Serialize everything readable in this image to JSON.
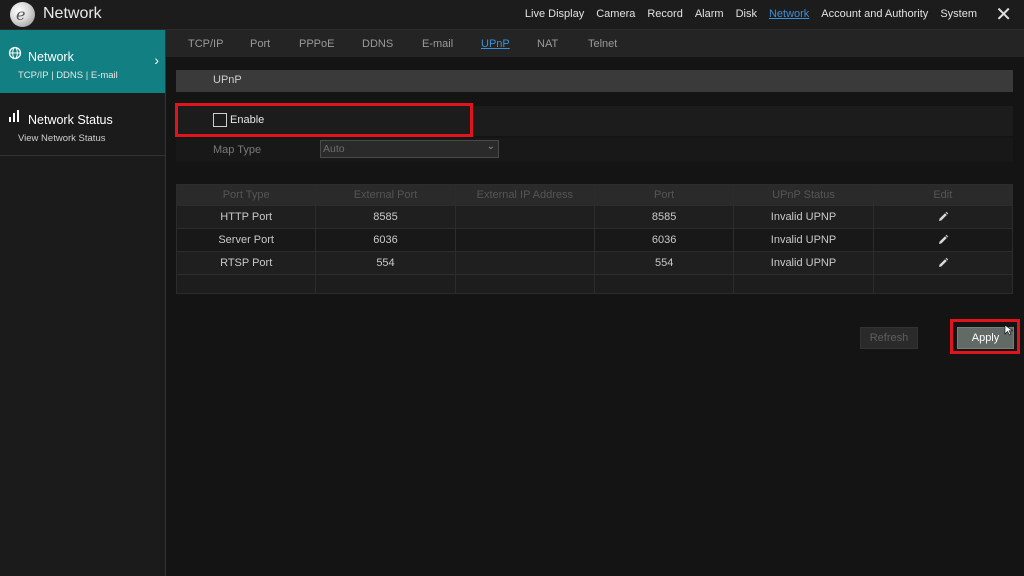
{
  "header": {
    "app_title": "Network",
    "nav_items": [
      {
        "label": "Live Display",
        "active": false
      },
      {
        "label": "Camera",
        "active": false
      },
      {
        "label": "Record",
        "active": false
      },
      {
        "label": "Alarm",
        "active": false
      },
      {
        "label": "Disk",
        "active": false
      },
      {
        "label": "Network",
        "active": true
      },
      {
        "label": "Account and Authority",
        "active": false
      },
      {
        "label": "System",
        "active": false
      }
    ],
    "close_icon": "close-icon"
  },
  "sidebar": {
    "items": [
      {
        "title": "Network",
        "subtitle": "TCP/IP | DDNS | E-mail",
        "icon": "globe-icon",
        "selected": true
      },
      {
        "title": "Network Status",
        "subtitle": "View Network Status",
        "icon": "signal-icon",
        "selected": false
      }
    ]
  },
  "subtabs": [
    {
      "label": "TCP/IP",
      "active": false
    },
    {
      "label": "Port",
      "active": false
    },
    {
      "label": "PPPoE",
      "active": false
    },
    {
      "label": "DDNS",
      "active": false
    },
    {
      "label": "E-mail",
      "active": false
    },
    {
      "label": "UPnP",
      "active": true
    },
    {
      "label": "NAT",
      "active": false
    },
    {
      "label": "Telnet",
      "active": false
    }
  ],
  "upnp": {
    "section_title": "UPnP",
    "enable_label": "Enable",
    "enable_checked": false,
    "map_type_label": "Map Type",
    "map_type_value": "Auto"
  },
  "table": {
    "headers": [
      "Port Type",
      "External Port",
      "External IP Address",
      "Port",
      "UPnP Status",
      "Edit"
    ],
    "rows": [
      {
        "port_type": "HTTP Port",
        "external_port": "8585",
        "external_ip": "",
        "port": "8585",
        "status": "Invalid UPNP"
      },
      {
        "port_type": "Server Port",
        "external_port": "6036",
        "external_ip": "",
        "port": "6036",
        "status": "Invalid UPNP"
      },
      {
        "port_type": "RTSP Port",
        "external_port": "554",
        "external_ip": "",
        "port": "554",
        "status": "Invalid UPNP"
      }
    ]
  },
  "buttons": {
    "refresh_label": "Refresh",
    "apply_label": "Apply"
  },
  "colors": {
    "accent": "#127f82",
    "active_link": "#3d8fd6",
    "highlight": "#e0141d"
  }
}
